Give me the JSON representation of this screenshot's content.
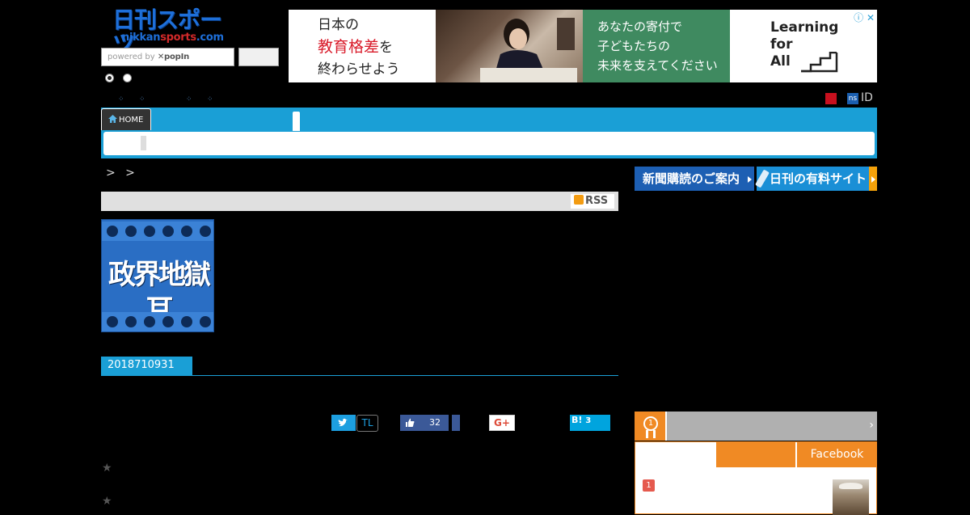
{
  "header": {
    "logo_top": "日刊スポーツ",
    "logo_bottom_a": "nikkan",
    "logo_bottom_b": "sports",
    "logo_bottom_c": ".com",
    "search_placeholder_prefix": "powered by ",
    "search_placeholder_brand": "✕popIn",
    "search_button_label": ""
  },
  "ad": {
    "line1": "日本の",
    "line2": "教育格差",
    "line2_tail": "を",
    "line3": "終わらせよう",
    "green_l1": "あなたの寄付で",
    "green_l2": "子どもたちの",
    "green_l3": "未来を支えてください",
    "brand_l1": "Learning",
    "brand_l2": "for",
    "brand_l3": "All",
    "info_icons": "ⓘ ✕",
    "accent_color": "#d91b2a"
  },
  "links_row": {
    "ns_badge": "ns",
    "id_label": "ID"
  },
  "nav": {
    "home_label": "HOME"
  },
  "breadcrumb": {
    "separator_text": "> >"
  },
  "section": {
    "rss_label": "RSS"
  },
  "thumb": {
    "title": "政界地獄耳"
  },
  "article": {
    "date_id": "2018710931"
  },
  "share": {
    "tl_label": "TL",
    "fb_count": "32",
    "gplus_label": "G+",
    "hatena_label": "B!",
    "hatena_count": "3"
  },
  "stars": [
    "★",
    "★"
  ],
  "right": {
    "promo1": "新聞購読のご案内",
    "promo2": "日刊の有料サイト",
    "ranking_medal": "1",
    "ranking_chevron": "›",
    "tab_facebook": "Facebook",
    "rank_num": "1"
  }
}
